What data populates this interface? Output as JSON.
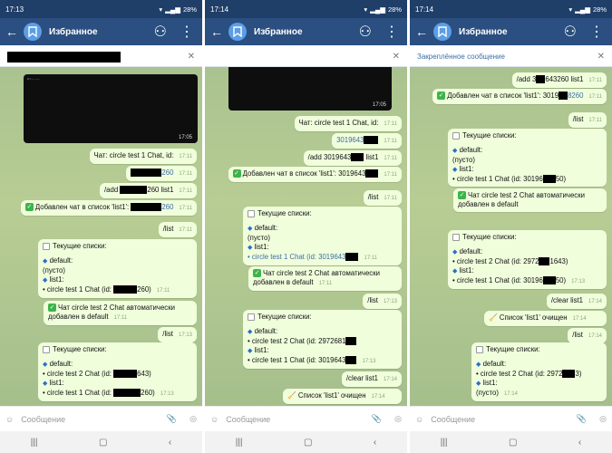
{
  "chat": {
    "title": "Избранное",
    "composer_placeholder": "Сообщение"
  },
  "status": {
    "battery": "28%"
  },
  "phones": [
    {
      "time": "17:13",
      "pinned": "",
      "image_time": "17:05",
      "messages": [
        {
          "text": "Чат: circle test 1 Chat, id:",
          "time": "17:11"
        },
        {
          "text": "260",
          "time": "17:11"
        },
        {
          "text": "/add",
          "text2": "260 list1",
          "time": "17:11"
        },
        {
          "text": "Добавлен чат в список 'list1':",
          "text2": "260",
          "time": "17:11"
        },
        {
          "text": "/list",
          "time": "17:11"
        },
        {
          "title": "Текущие списки:",
          "lines": [
            "default:",
            "(пусто)",
            "list1:",
            "• circle test 1 Chat (id:",
            "260)"
          ],
          "time": "17:11"
        },
        {
          "text": "Чат circle test 2 Chat автоматически добавлен в default",
          "time": "17:11"
        },
        {
          "text": "/list",
          "time": "17:13"
        },
        {
          "title": "Текущие списки:",
          "lines": [
            "default:",
            "• circle test 2 Chat (id:",
            "643)",
            "list1:",
            "• circle test 1 Chat (id:",
            "260)"
          ],
          "time": "17:13"
        }
      ]
    },
    {
      "time": "17:14",
      "pinned": "",
      "image_time": "17:05",
      "messages": [
        {
          "text": "Чат: circle test 1 Chat, id:",
          "time": "17:11"
        },
        {
          "text": "3019643",
          "time": "17:11"
        },
        {
          "text": "/add 3019643",
          "text2": "list1",
          "time": "17:11"
        },
        {
          "text": "Добавлен чат в список 'list1': 3019643",
          "time": "17:11"
        },
        {
          "text": "/list",
          "time": "17:11"
        },
        {
          "title": "Текущие списки:",
          "lines": [
            "default:",
            "(пусто)",
            "list1:",
            "• circle test 1 Chat (id: 3019643"
          ],
          "time": "17:11"
        },
        {
          "text": "Чат circle test 2 Chat автоматически добавлен в default",
          "time": "17:11"
        },
        {
          "text": "/list",
          "time": "17:13"
        },
        {
          "title": "Текущие списки:",
          "lines": [
            "default:",
            "• circle test 2 Chat (id: 2972681",
            "list1:",
            "• circle test 1 Chat (id: 3019643"
          ],
          "time": "17:13"
        },
        {
          "text": "/clear list1",
          "time": "17:14"
        },
        {
          "text": "Список 'list1' очищен",
          "time": "17:14"
        }
      ]
    },
    {
      "time": "17:14",
      "pinned": "Закреплённое сообщение",
      "messages": [
        {
          "text": "/add 3",
          "text2": "643260 list1",
          "time": "17:11"
        },
        {
          "text": "Добавлен чат в список 'list1': 3019",
          "text2": "8260",
          "time": "17:11"
        },
        {
          "text": "/list",
          "time": "17:11"
        },
        {
          "title": "Текущие списки:",
          "lines": [
            "default:",
            "(пусто)",
            "list1:",
            "• circle test 1 Chat (id: 30196",
            "50)"
          ],
          "time": "17:11"
        },
        {
          "text": "Чат circle test 2 Chat автоматически добавлен в default",
          "time": "17:11"
        },
        {
          "title": "Текущие списки:",
          "lines": [
            "default:",
            "• circle test 2 Chat (id: 2972",
            "1643)",
            "list1:",
            "• circle test 1 Chat (id: 30196",
            "50)"
          ],
          "time": "17:13"
        },
        {
          "text": "/clear list1",
          "time": "17:14"
        },
        {
          "text": "Список 'list1' очищен",
          "time": "17:14"
        },
        {
          "text": "/list",
          "time": "17:14"
        },
        {
          "title": "Текущие списки:",
          "lines": [
            "default:",
            "• circle test 2 Chat (id: 2972",
            "3)",
            "list1:",
            "(пусто)"
          ],
          "time": "17:14"
        }
      ]
    }
  ]
}
